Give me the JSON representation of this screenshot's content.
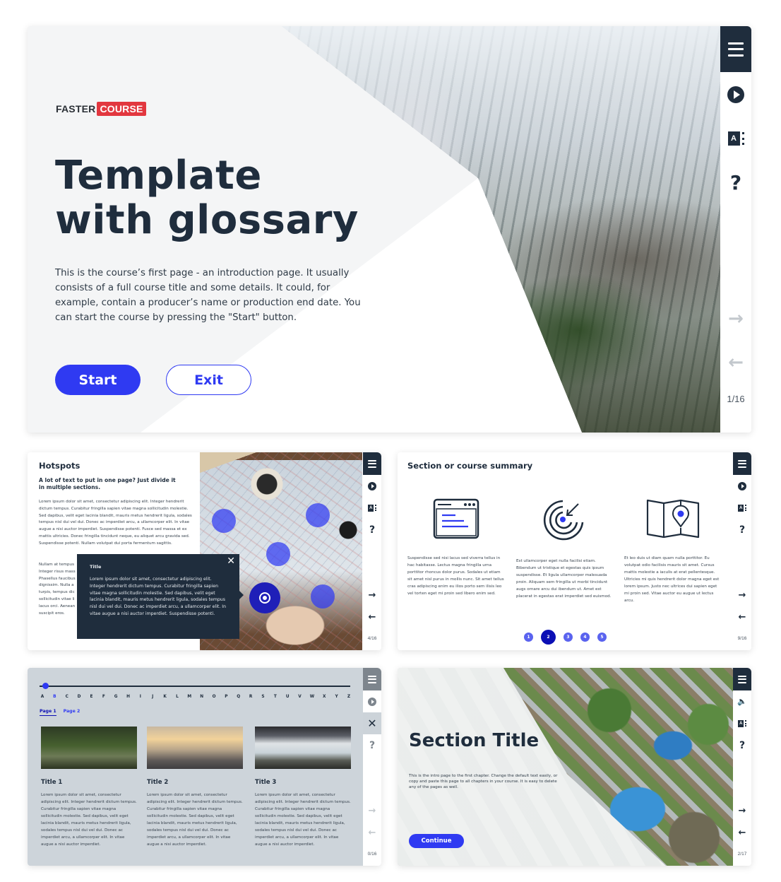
{
  "colors": {
    "primary": "#2f3af2",
    "dark": "#1f2d3d",
    "brand_red": "#e2373f",
    "pager_active": "#0b0fb5",
    "glossary_bg": "#cdd4da"
  },
  "sidebar_icons": {
    "menu": "hamburger-icon",
    "play": "play-circle-icon",
    "glossary": "glossary-icon",
    "help": "question-icon",
    "next": "arrow-right-icon",
    "prev": "arrow-left-icon",
    "close": "close-icon",
    "sound": "speaker-icon"
  },
  "slide1": {
    "logo": {
      "part1": "FASTER",
      "part2": "COURSE"
    },
    "title_line1": "Template",
    "title_line2": "with glossary",
    "description": "This is the course’s first page - an introduction page. It usually consists of a full course title and some details. It could, for example, contain a producer’s name or production end date. You can start the course by pressing the \"Start\" button.",
    "start_label": "Start",
    "exit_label": "Exit",
    "page_counter": "1/16",
    "glossary_letter": "A",
    "help_glyph": "?",
    "next_glyph": "→",
    "prev_glyph": "←"
  },
  "slide2": {
    "title": "Hotspots",
    "subtitle": "A lot of text to put in one page? Just divide it in multiple sections.",
    "body": "Lorem ipsum dolor sit amet, consectetur adipiscing elit. Integer hendrerit dictum tempus. Curabitur fringilla sapien vitae magna sollicitudin molestie. Sed dapibus, velit eget lacinia blandit, mauris metus hendrerit ligula, sodales tempus nisl dui vel dui. Donec ac imperdiet arcu, a ullamcorper elit. In vitae augue a nisi auctor imperdiet. Suspendisse potenti. Fusce sed massa et ex mattis ultricies. Donec fringilla tincidunt neque, eu aliquet arcu gravida sed. Suspendisse potenti. Nullam volutpat dui porta fermentum sagittis.",
    "body2": "Nullam at tempus\nInteger risus mass\nPhasellus faucibus\ndignissim. Nulla a\nturpis, tempus dic\nsollicitudin vitae li\nlacus orci. Aenean\nsuscipit eros.",
    "popup": {
      "title": "Title",
      "body": "Lorem ipsum dolor sit amet, consectetur adipiscing elit. Integer hendrerit dictum tempus. Curabitur fringilla sapien vitae magna sollicitudin molestie. Sed dapibus, velit eget lacinia blandit, mauris metus hendrerit ligula, sodales tempus nisl dui vel dui. Donec ac imperdiet arcu, a ullamcorper elit. In vitae augue a nisi auctor imperdiet. Suspendisse potenti.",
      "close_glyph": "✕"
    },
    "hotspot_count": 6,
    "page_counter": "4/16"
  },
  "slide3": {
    "title": "Section or course summary",
    "columns": [
      {
        "icon": "browser-window-icon",
        "text": "Suspendisse sed nisi lacus sed viverra tellus in hac habitasse. Lectus magna fringilla urna porttitor rhoncus dolor purus. Sodales ut etiam sit amet nisl purus in mollis nunc. Sit amet tellus cras adipiscing enim eu ilios porto sem ilisis leo vel torten eget mi proin sed libero enim sed."
      },
      {
        "icon": "target-radar-icon",
        "text": "Est ullamcorper eget nulla facilisi etiam. Bibendum ut tristique et egestas quis ipsum suspendisse. Et ligula ullamcorper malesuada proin. Aliquam sem fringilla ut morbi tincidunt augs ornare arcu dui ibendum ut. Amet est placerat in egestas erat imperdiet sed euismod."
      },
      {
        "icon": "map-pin-icon",
        "text": "Et leo duis ut diam quam nulla porttitor. Eu volutpat odio facilisis mauris sit amet. Cursus mattis molestie a iaculis at erat pellentesque. Ultricies mi quis hendrerit dolor magna eget est lorem ipsum. Justo nec ultrices dui sapien eget mi proin sed. Vitae auctor eu augue ut lectus arcu."
      }
    ],
    "pager": [
      "1",
      "2",
      "3",
      "4",
      "5"
    ],
    "pager_active": "2",
    "page_counter": "9/16"
  },
  "slide4": {
    "letters": [
      "A",
      "B",
      "C",
      "D",
      "E",
      "F",
      "G",
      "H",
      "I",
      "J",
      "K",
      "L",
      "M",
      "N",
      "O",
      "P",
      "Q",
      "R",
      "S",
      "T",
      "U",
      "V",
      "W",
      "X",
      "Y",
      "Z"
    ],
    "selected_letter": "B",
    "page_tabs": [
      "Page 1",
      "Page 2"
    ],
    "selected_tab": "Page 1",
    "items": [
      {
        "title": "Title 1",
        "text": "Lorem ipsum dolor sit amet, consectetur adipiscing elit. Integer hendrerit dictum tempus. Curabitur fringilla sapien vitae magna sollicitudin molestie. Sed dapibus, velit eget lacinia blandit, mauris metus hendrerit ligula, sodales tempus nisl dui vel dui. Donec ac imperdiet arcu, a ullamcorper elit. In vitae augue a nisi auctor imperdiet."
      },
      {
        "title": "Title 2",
        "text": "Lorem ipsum dolor sit amet, consectetur adipiscing elit. Integer hendrerit dictum tempus. Curabitur fringilla sapien vitae magna sollicitudin molestie. Sed dapibus, velit eget lacinia blandit, mauris metus hendrerit ligula, sodales tempus nisl dui vel dui. Donec ac imperdiet arcu, a ullamcorper elit. In vitae augue a nisi auctor imperdiet."
      },
      {
        "title": "Title 3",
        "text": "Lorem ipsum dolor sit amet, consectetur adipiscing elit. Integer hendrerit dictum tempus. Curabitur fringilla sapien vitae magna sollicitudin molestie. Sed dapibus, velit eget lacinia blandit, mauris metus hendrerit ligula, sodales tempus nisl dui vel dui. Donec ac imperdiet arcu, a ullamcorper elit. In vitae augue a nisi auctor imperdiet."
      }
    ],
    "page_counter": "0/16",
    "close_glyph": "✕"
  },
  "slide5": {
    "title": "Section Title",
    "description": "This is the intro page to the first chapter. Change the default text easily, or copy and paste this page to all chapters in your course. It is easy to delete any of the pages as well.",
    "continue_label": "Continue",
    "page_counter": "2/17",
    "sound_glyph": "🔈"
  }
}
